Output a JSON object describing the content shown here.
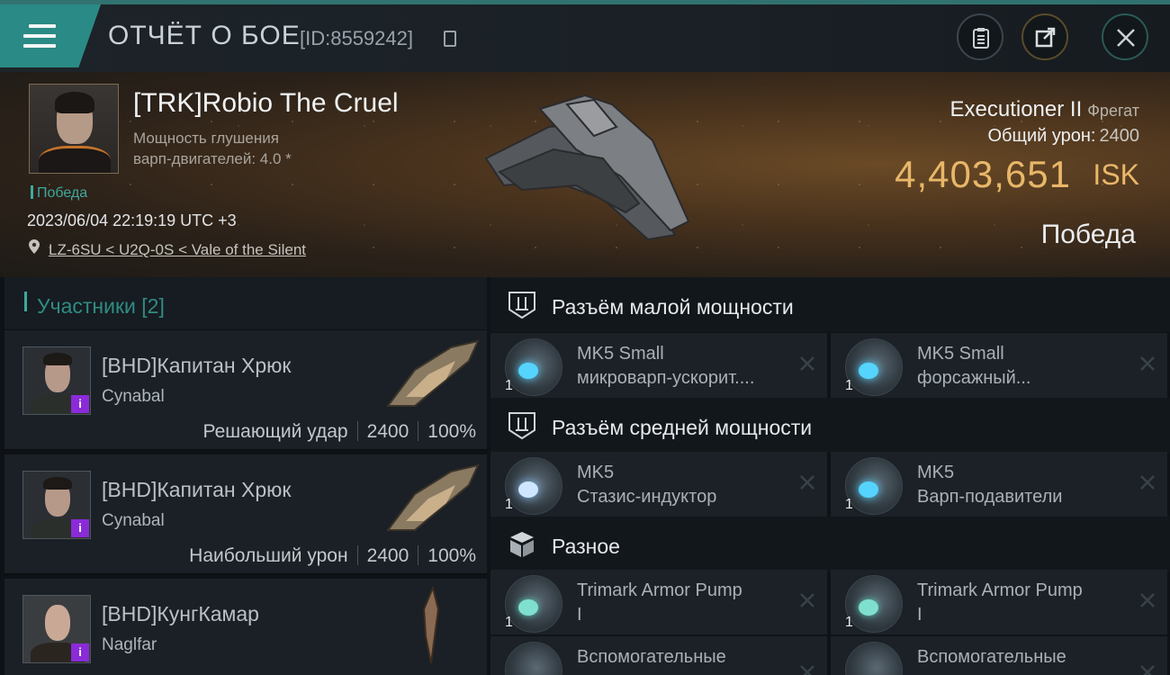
{
  "header": {
    "title": "ОТЧЁТ О БОЕ",
    "report_id": "[ID:8559242]",
    "icons": {
      "menu": "hamburger-menu-icon",
      "copy": "copy-icon",
      "clipboard": "clipboard-icon",
      "share": "share-icon",
      "close": "close-icon"
    }
  },
  "victim": {
    "name": "[TRK]Robio The Cruel",
    "stat_line1": "Мощность глушения",
    "stat_line2": "варп-двигателей: 4.0 *",
    "result_tag": "Победа",
    "timestamp": "2023/06/04 22:19:19 UTC +3",
    "location": "LZ-6SU < U2Q-0S < Vale of the Silent",
    "ship_name": "Executioner II",
    "ship_class": "Фрегат",
    "total_damage_label": "Общий урон:",
    "total_damage_value": "2400",
    "isk_value": "4,403,651",
    "isk_unit": "ISK",
    "outcome": "Победа"
  },
  "participants": {
    "title": "Участники [2]",
    "items": [
      {
        "name": "[BHD]Капитан Хрюк",
        "ship": "Cynabal",
        "role": "Решающий удар",
        "damage": "2400",
        "percent": "100%"
      },
      {
        "name": "[BHD]Капитан Хрюк",
        "ship": "Cynabal",
        "role": "Наибольший урон",
        "damage": "2400",
        "percent": "100%"
      },
      {
        "name": "[BHD]КунгКамар",
        "ship": "Naglfar",
        "role": "",
        "damage": "",
        "percent": ""
      }
    ],
    "badge_glyph": "i",
    "badge_color": "#8a2bd8"
  },
  "fitting": {
    "low_slot": {
      "label": "Разъём малой мощности",
      "modules": [
        {
          "qty": "1",
          "line1": "MK5 Small",
          "line2": "микроварп-ускорит...."
        },
        {
          "qty": "1",
          "line1": "MK5 Small",
          "line2": "форсажный..."
        }
      ]
    },
    "mid_slot": {
      "label": "Разъём средней мощности",
      "modules": [
        {
          "qty": "1",
          "line1": "MK5",
          "line2": "Стазис-индуктор"
        },
        {
          "qty": "1",
          "line1": "MK5",
          "line2": "Варп-подавители"
        }
      ]
    },
    "misc": {
      "label": "Разное",
      "modules": [
        {
          "qty": "1",
          "line1": "Trimark Armor Pump",
          "line2": "I"
        },
        {
          "qty": "1",
          "line1": "Trimark Armor Pump",
          "line2": "I"
        },
        {
          "qty": "",
          "line1": "Вспомогательные",
          "line2": ""
        },
        {
          "qty": "",
          "line1": "Вспомогательные",
          "line2": ""
        }
      ]
    }
  },
  "colors": {
    "accent_teal": "#3fa89d",
    "isk_gold": "#e8b769",
    "badge_purple": "#8a2bd8"
  }
}
